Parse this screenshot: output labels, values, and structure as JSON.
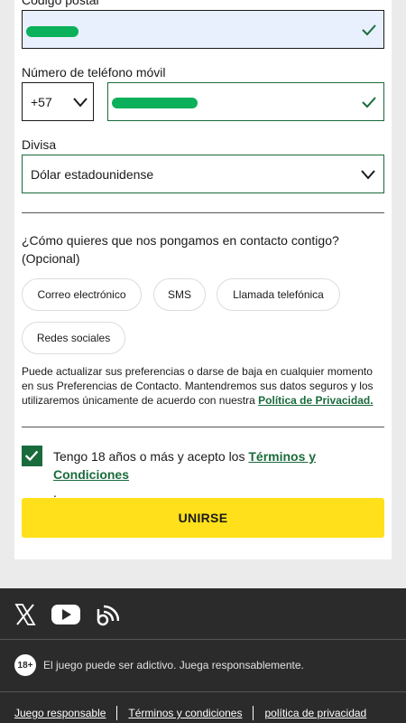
{
  "form": {
    "postal_label": "Código postal",
    "phone_label": "Número de teléfono móvil",
    "phone_prefix": "+57",
    "currency_label": "Divisa",
    "currency_value": "Dólar estadounidense",
    "contact_question": "¿Cómo quieres que nos pongamos en contacto contigo? (Opcional)",
    "contact_options": [
      "Correo electrónico",
      "SMS",
      "Llamada telefónica",
      "Redes sociales"
    ],
    "info_text": "Puede actualizar sus preferencias o darse de baja en cualquier momento en sus Preferencias de Contacto. Mantendremos sus datos seguros y los utilizaremos únicamente de acuerdo con nuestra ",
    "privacy_link": "Política de Privacidad.",
    "terms_text": "Tengo 18 años o más y acepto los ",
    "terms_link": "Términos y Condiciones",
    "terms_end": ".",
    "join_label": "UNIRSE"
  },
  "footer": {
    "age_badge": "18+",
    "responsible_text": "El juego puede ser adictivo. Juega responsablemente.",
    "links": [
      "Juego responsable",
      "Términos y condiciones",
      "política de privacidad"
    ],
    "social_icons": [
      "x-icon",
      "youtube-icon",
      "blog-icon"
    ]
  },
  "colors": {
    "accent_green": "#1a6b3c",
    "button_yellow": "#ffe01a",
    "footer_bg": "#2b2b2b"
  }
}
